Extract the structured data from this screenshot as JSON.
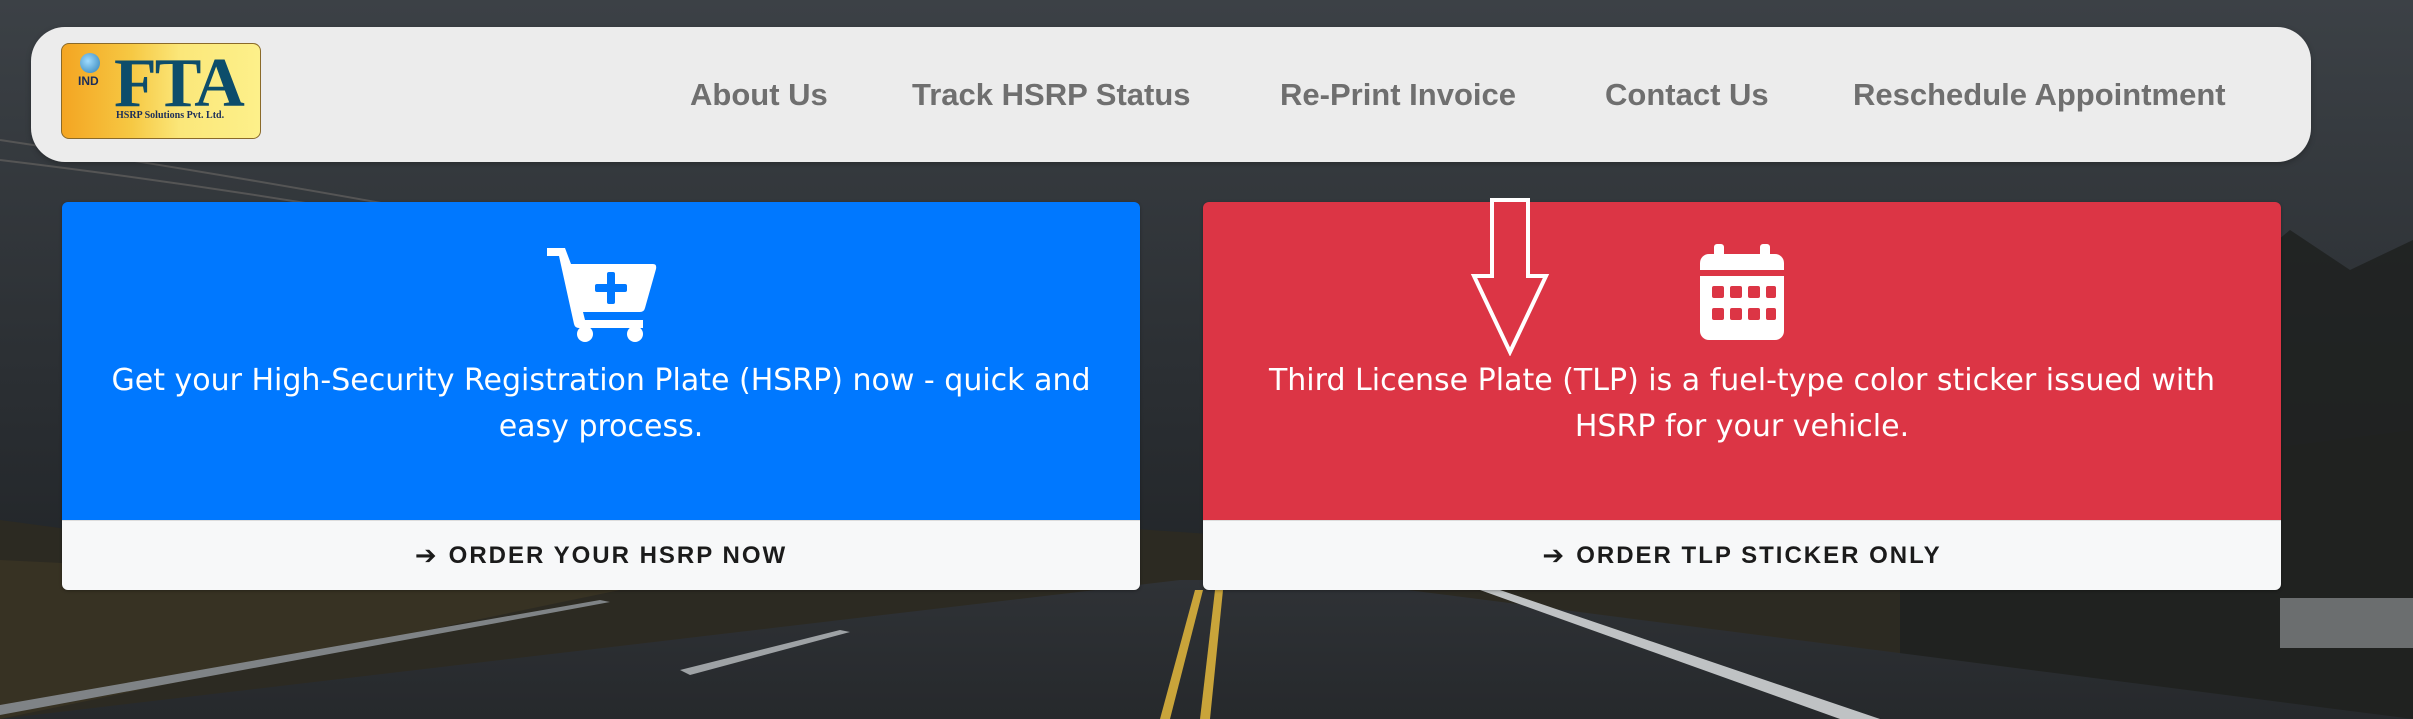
{
  "brand": {
    "logo_code": "IND",
    "logo_name": "FTA",
    "logo_subtitle": "HSRP Solutions Pvt. Ltd."
  },
  "nav": {
    "items": [
      {
        "label": "About Us"
      },
      {
        "label": "Track HSRP Status"
      },
      {
        "label": "Re-Print Invoice"
      },
      {
        "label": "Contact Us"
      },
      {
        "label": "Reschedule Appointment"
      }
    ]
  },
  "cards": {
    "hsrp": {
      "icon": "cart-plus-icon",
      "text": "Get your High-Security Registration Plate (HSRP) now - quick and easy process.",
      "button_label": "ORDER YOUR HSRP NOW",
      "color": "#0078ff"
    },
    "tlp": {
      "icon": "calendar-icon",
      "text": "Third License Plate (TLP) is a fuel-type color sticker issued with HSRP for your vehicle.",
      "button_label": "ORDER TLP STICKER ONLY",
      "color": "#dc3545"
    }
  },
  "colors": {
    "nav_bg": "#ececec",
    "nav_text": "#6f6f6f",
    "footer_bg": "#f7f8f9"
  }
}
